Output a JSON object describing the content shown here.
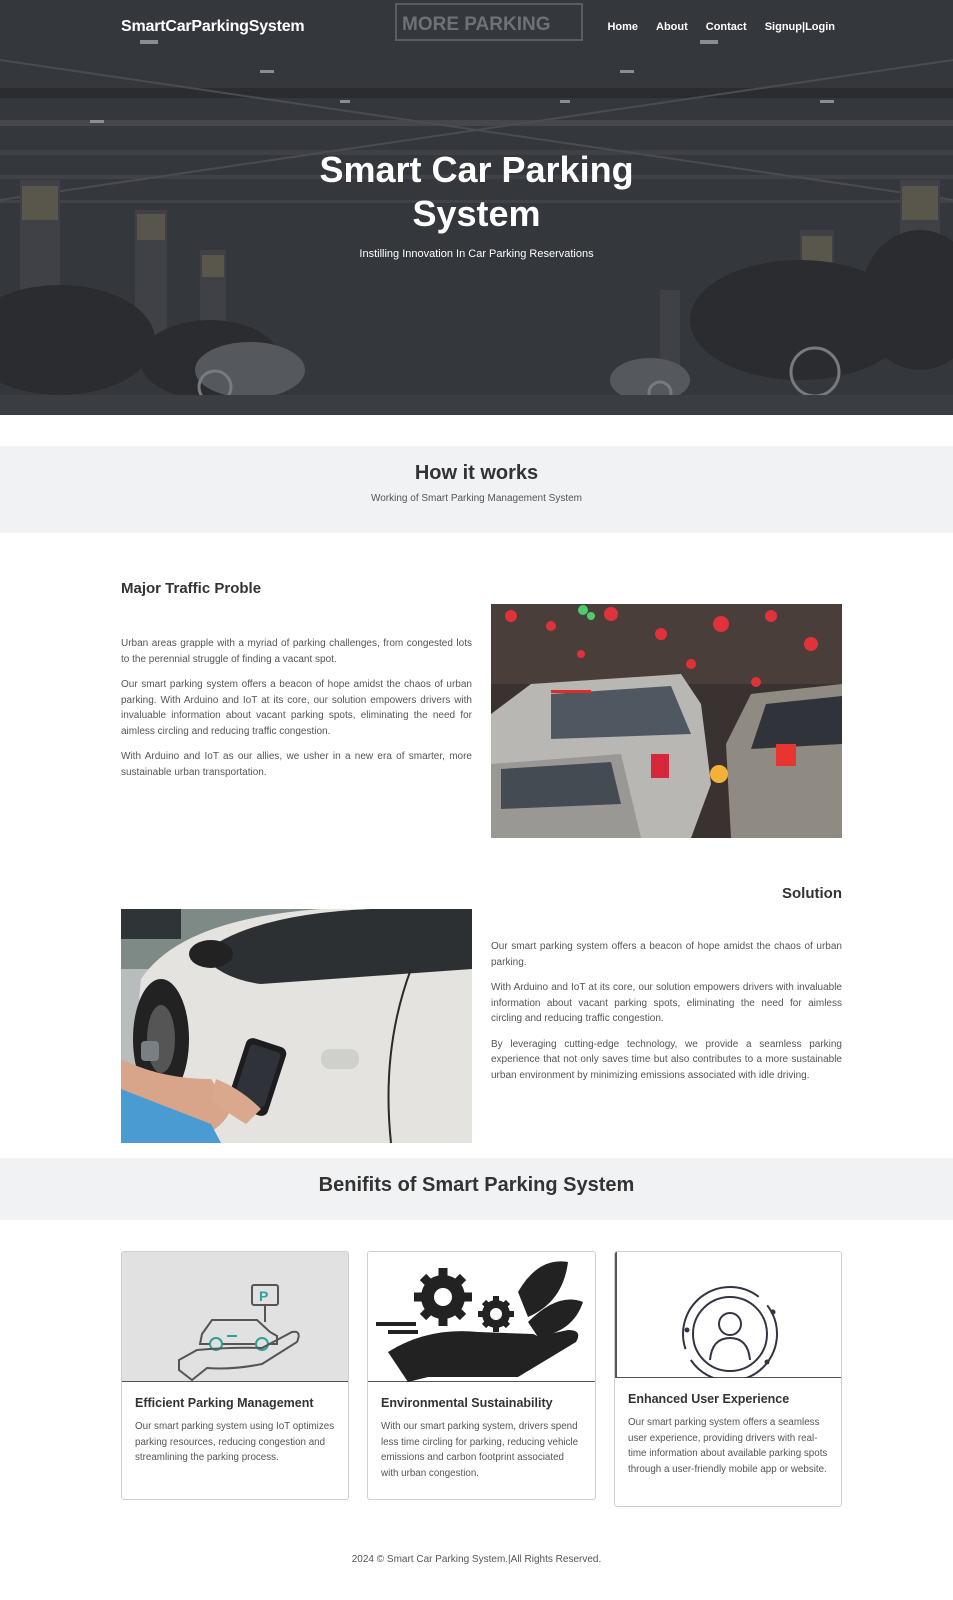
{
  "nav": {
    "brand": "SmartCarParkingSystem",
    "links": [
      "Home",
      "About",
      "Contact",
      "Signup|Login"
    ]
  },
  "hero": {
    "title_line1": "Smart Car Parking",
    "title_line2": "System",
    "subtitle": "Instilling Innovation In Car Parking Reservations",
    "sign_text": "MORE PARKING"
  },
  "how": {
    "title": "How it works",
    "subtitle": "Working of Smart Parking Management System"
  },
  "problem": {
    "title": "Major Traffic Proble",
    "paragraphs": [
      "Urban areas grapple with a myriad of parking challenges, from congested lots to the perennial struggle of finding a vacant spot.",
      "Our smart parking system offers a beacon of hope amidst the chaos of urban parking. With Arduino and IoT at its core, our solution empowers drivers with invaluable information about vacant parking spots, eliminating the need for aimless circling and reducing traffic congestion.",
      "With Arduino and IoT as our allies, we usher in a new era of smarter, more sustainable urban transportation."
    ]
  },
  "solution": {
    "title": "Solution",
    "paragraphs": [
      "Our smart parking system offers a beacon of hope amidst the chaos of urban parking.",
      "With Arduino and IoT at its core, our solution empowers drivers with invaluable information about vacant parking spots, eliminating the need for aimless circling and reducing traffic congestion.",
      "By leveraging cutting-edge technology, we provide a seamless parking experience that not only saves time but also contributes to a more sustainable urban environment by minimizing emissions associated with idle driving."
    ]
  },
  "benefits": {
    "title": "Benifits of Smart Parking System",
    "cards": [
      {
        "title": "Efficient Parking Management",
        "text": "Our smart parking system using IoT optimizes parking resources, reducing congestion and streamlining the parking process."
      },
      {
        "title": "Environmental Sustainability",
        "text": "With our smart parking system, drivers spend less time circling for parking, reducing vehicle emissions and carbon footprint associated with urban congestion."
      },
      {
        "title": "Enhanced User Experience",
        "text": "Our smart parking system offers a seamless user experience, providing drivers with real-time information about available parking spots through a user-friendly mobile app or website."
      }
    ],
    "parking_sign_letter": "P"
  },
  "footer": {
    "text": "2024 © Smart Car Parking System.|All Rights Reserved."
  },
  "colors": {
    "hero_overlay": "#33363b",
    "band_bg": "#f1f2f4",
    "accent_teal": "#29a39b"
  }
}
